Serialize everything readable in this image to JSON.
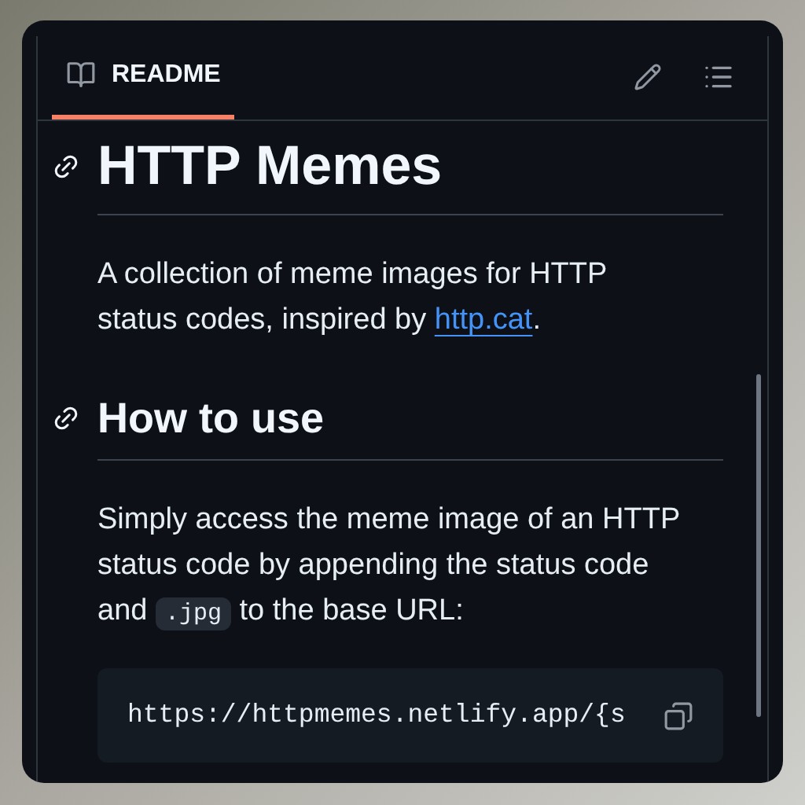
{
  "tabs": [
    {
      "label": "README",
      "selected": true
    }
  ],
  "sections": [
    {
      "heading": "HTTP Memes",
      "kind": "title",
      "paragraph": [
        {
          "kind": "text",
          "text": "A collection of meme images for HTTP status codes, inspired by "
        },
        {
          "kind": "link",
          "text": "http.cat"
        },
        {
          "kind": "text",
          "text": "."
        }
      ]
    },
    {
      "heading": "How to use",
      "kind": "section",
      "paragraph": [
        {
          "kind": "text",
          "text": "Simply access the meme image of an HTTP status code by appending the status code and "
        },
        {
          "kind": "code",
          "text": ".jpg"
        },
        {
          "kind": "text",
          "text": " to the base URL:"
        }
      ],
      "code_block": "https://httpmemes.netlify.app/{s"
    }
  ]
}
